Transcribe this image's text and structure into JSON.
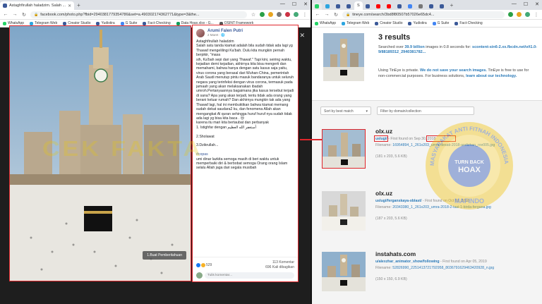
{
  "left_browser": {
    "tab_title": "Astaghfirullah haladzim. Salah ...",
    "new_tab": "+",
    "url": "facebook.com/photo.php?fbid=2940381779354786&set=a.490302174362771&type=3&the...",
    "bookmarks": [
      "WhatsApp",
      "Telegram Web",
      "Creator Studio",
      "Yudistira",
      "G Suite",
      "Fact-Checking",
      "Data Hoax.xlsx - G...",
      "OSINT Framework"
    ]
  },
  "right_browser": {
    "tab_label": "S",
    "url": "tineye.com/search/3bd8f80507b57026e65dc4...",
    "bookmarks": [
      "WhatsApp",
      "Telegram Web",
      "Creator Studio",
      "Yudistira",
      "G Suite",
      "Fact-Checking"
    ]
  },
  "window_controls": {
    "minimize": "—",
    "maximize": "☐",
    "close": "✕"
  },
  "fb_post": {
    "author": "Arumi Falen Putri",
    "date": "2 Maret · ",
    "body_intro": "Astaghfirullah haladzim\nSalah satu tanda kiamat adalah bila sudah tidak ada lagi yg Thawaf mengelilingi Ka'bah. Dulu kita mungkin pernah berpikir, \"masa\nsih, Ka'bah sepi dari yang Thawaf.\" Tapi kini, seiring waktu, kejadian demi kejadian, akhirnya kita bisa mengerti dan memahami, bahwa hanya dengan satu kasus saja yaitu, virus corona yang berasal dari Wuhan-China, pemerintah Arab Saudi menutup pintu masuk bandaranya untuk seluruh negara yang terinfeksi dengan virus corona, termasuk pada jamaah yang akan melaksanakan ibadah\numroh.Pertanyaannya bagaimana jika kasus tersebut terjadi di sana? Apa yang akan terjadi, tentu tidak ada orang yang berani keluar rumah? Dan akhirnya mungkin tak ada yang Thawaf lagi, hal ini membuktikan bahwa kiamat memang sudah dekat saudara2 ku, dan fenomena Allah akan mengangkat Al quran sehingga huruf huruf nya sudah tidak ada lagi yg bisa kita baca . 😢\nkarena itu mari kita bertaubat dan perbanyak\n1. Istighfar dengan ",
    "arabic": "أستغفر الله العظيم",
    "body_rest": "\n\n2.Sholawat\n\n3.Dzikrullah...\n\n",
    "hashtag": "#copas",
    "body_outro": "\numi dinar lazkita semoga masih di beri waktu untuk memperbaiki diri & berbobat semoga Orang orang Islam selalu Allah jaga dari segala musibah",
    "reaction_count": "529",
    "comments": "113 Komentar",
    "shares": "696 Kali dibagikan",
    "comment_placeholder": "Tulis komentar...",
    "photo_button": "1.Buat Pemberitahuan"
  },
  "watermark": "CEK FAKTA",
  "tineye": {
    "results_title": "3 results",
    "searched_prefix": "Searched over ",
    "searched_count": "39.9 billion",
    "searched_mid": " images in 0.8 seconds for: ",
    "searched_file": "scontent-sin6-2.xx.fbcdn.net/v/t1.0-9/88189312_2940381782...",
    "privacy_prefix": "Using TinEye is private. ",
    "privacy_link1": "We do not save your search images.",
    "privacy_mid": " TinEye is free to use for non-commercial purposes. For business solutions, ",
    "privacy_link2": "learn about our technology.",
    "sort_label": "Sort by best match",
    "filter_label": "Filter by domain/collection",
    "results": [
      {
        "site": "olx.uz",
        "path": "uslugi/",
        "found": " - First found on Sep 30, 2018",
        "filename_label": "Filename: ",
        "filename": "16954894_1_261x203_umra-desati-2018-andizhan_rov005.jpg",
        "dims": "(181 x 203, 5.6 KB)"
      },
      {
        "site": "olx.uz",
        "path": "uslugi/ferganskaya-oblast/",
        "found": " - First found on Oct 01, 2018",
        "filename_label": "Filename: ",
        "filename": "20343380_1_261x203_umra-2018-2-tasi-1-birda-fergana.jpg",
        "dims": "(187 x 203, 5.6 KB)"
      },
      {
        "site": "instahats.com",
        "path": "u/alexzhar_animator_show/following",
        "found": " - First found on Apr 05, 2019",
        "filename_label": "Filename: ",
        "filename": "52826990_2251413721792958_8036791629463420928_n.jpg",
        "dims": "(150 x 150, 6.9 KB)"
      }
    ]
  },
  "seal": {
    "ring_text": "MASYARAKAT ANTI FITNAH INDONESIA",
    "center": "TURN BACK",
    "center2": "HOAX",
    "bottom": "MAFINDO"
  },
  "colors": {
    "highlight": "#e0262b",
    "link": "#2a7ab8",
    "fb_blue": "#385898"
  }
}
